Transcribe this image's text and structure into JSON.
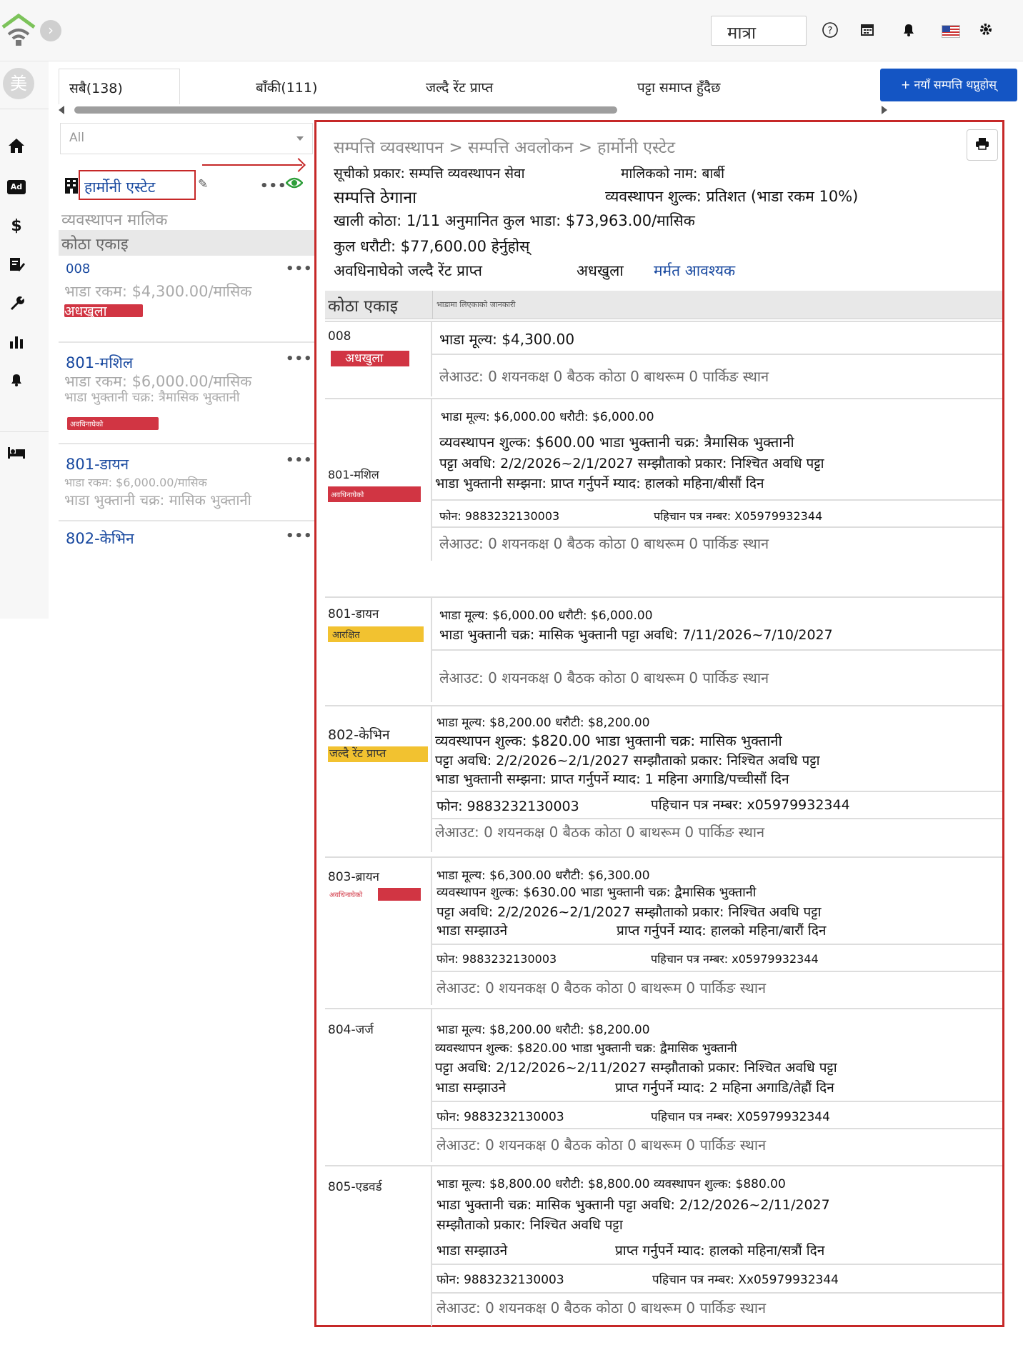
{
  "topbar": {
    "search_value": "मात्रा",
    "icons": [
      "help-icon",
      "calendar-icon",
      "bell-icon",
      "flag-icon",
      "gear-icon"
    ]
  },
  "avatar_text": "美",
  "tabs": [
    {
      "label": "सबै(138)"
    },
    {
      "label": "बाँकी(111)"
    },
    {
      "label": "जल्दै रेंट प्राप्त"
    },
    {
      "label": "पट्टा समाप्त हुँदैछ"
    }
  ],
  "add_button_label": "+ नयाँ सम्पत्ति थप्नुहोस्",
  "filter": {
    "value": "All"
  },
  "sidebar": {
    "property_name": "हार्मोनी एस्टेट",
    "owner_label": "व्यवस्थापन मालिक",
    "unit_header": "कोठा एकाइ",
    "units": [
      {
        "name": "008",
        "line1": "भाडा रकम: $4,300.00/मासिक",
        "badge": "अधखुला"
      },
      {
        "name": "801-मशिल",
        "line1": "भाडा रकम: $6,000.00/मासिक",
        "line2": "भाडा भुक्तानी चक्र: त्रैमासिक भुक्तानी",
        "badge": "अवधिनाघेको"
      },
      {
        "name": "801-डायन",
        "line1": "भाडा रकम: $6,000.00/मासिक",
        "line2": "भाडा भुक्तानी चक्र: मासिक भुक्तानी"
      },
      {
        "name": "802-केभिन"
      }
    ]
  },
  "main": {
    "breadcrumb": "सम्पत्ति व्यवस्थापन > सम्पत्ति अवलोकन > हार्मोनी एस्टेट",
    "list_type": "सूचीको प्रकार: सम्पत्ति व्यवस्थापन सेवा",
    "owner_name": "मालिकको नाम: बार्बी",
    "address_label": "सम्पत्ति ठेगाना",
    "management_fee": "व्यवस्थापन शुल्क: प्रतिशत (भाडा रकम 10%)",
    "vacant": "खाली कोठा: 1/11 अनुमानित कुल भाडा: $73,963.00/मासिक",
    "deposit": "कुल धरौटी: $77,600.00 हेर्नुहोस्",
    "overdue_filter": "अवधिनाघेको जल्दै रेंट प्राप्त",
    "half_open": "अधखुला",
    "repair": "मर्मत आवश्यक",
    "header_unit": "कोठा एकाइ",
    "header_tenant": "भाडामा लिएकाको जानकारी"
  },
  "units": [
    {
      "name": "008",
      "badge": "अधखुला",
      "rent_price": "भाडा मूल्य: $4,300.00",
      "layout": "लेआउट: 0 शयनकक्ष 0 बैठक कोठा 0 बाथरूम 0 पार्किङ स्थान"
    },
    {
      "name": "801-मशिल",
      "badge": "अवधिनाघेको",
      "rent_deposit": "भाडा मूल्य: $6,000.00 धरौटी: $6,000.00",
      "fee_cycle": "व्यवस्थापन शुल्क: $600.00 भाडा भुक्तानी चक्र: त्रैमासिक भुक्तानी",
      "lease": "पट्टा अवधि: 2/2/2026~2/1/2027 सम्झौताको प्रकार: निश्चित अवधि पट्टा",
      "reminder": "भाडा भुक्तानी सम्झना: प्राप्त गर्नुपर्ने म्याद: हालको महिना/बीसौं दिन",
      "phone": "फोन: 9883232130003",
      "id_number": "पहिचान पत्र नम्बर: X05979932344",
      "layout": "लेआउट: 0 शयनकक्ष 0 बैठक कोठा 0 बाथरूम 0 पार्किङ स्थान"
    },
    {
      "name": "801-डायन",
      "badge": "आरक्षित",
      "rent_deposit": "भाडा मूल्य: $6,000.00 धरौटी: $6,000.00",
      "cycle_lease": "भाडा भुक्तानी चक्र: मासिक भुक्तानी पट्टा अवधि: 7/11/2026~7/10/2027",
      "layout": "लेआउट: 0 शयनकक्ष 0 बैठक कोठा 0 बाथरूम 0 पार्किङ स्थान"
    },
    {
      "name": "802-केभिन",
      "badge": "जल्दै रेंट प्राप्त",
      "rent_deposit": "भाडा मूल्य: $8,200.00 धरौटी: $8,200.00",
      "fee_cycle": "व्यवस्थापन शुल्क: $820.00 भाडा भुक्तानी चक्र: मासिक भुक्तानी",
      "lease": "पट्टा अवधि: 2/2/2026~2/1/2027 सम्झौताको प्रकार: निश्चित अवधि पट्टा",
      "reminder": "भाडा भुक्तानी सम्झना: प्राप्त गर्नुपर्ने म्याद: 1 महिना अगाडि/पच्चीसौं दिन",
      "phone": "फोन: 9883232130003",
      "id_number": "पहिचान पत्र नम्बर: x05979932344",
      "layout": "लेआउट: 0 शयनकक्ष 0 बैठक कोठा 0 बाथरूम 0 पार्किङ स्थान"
    },
    {
      "name": "803-ब्रायन",
      "badge": "अवधिनाघेको",
      "rent_deposit": "भाडा मूल्य: $6,300.00 धरौटी: $6,300.00",
      "fee_cycle": "व्यवस्थापन शुल्क: $630.00 भाडा भुक्तानी चक्र: द्वैमासिक भुक्तानी",
      "lease": "पट्टा अवधि: 2/2/2026~2/1/2027 सम्झौताको प्रकार: निश्चित अवधि पट्टा",
      "reminder_label": "भाडा सम्झाउने",
      "reminder_due": "प्राप्त गर्नुपर्ने म्याद: हालको महिना/बारौं दिन",
      "phone": "फोन: 9883232130003",
      "id_number": "पहिचान पत्र नम्बर: x05979932344",
      "layout": "लेआउट: 0 शयनकक्ष 0 बैठक कोठा 0 बाथरूम 0 पार्किङ स्थान"
    },
    {
      "name": "804-जर्ज",
      "rent_deposit": "भाडा मूल्य: $8,200.00 धरौटी: $8,200.00",
      "fee_cycle": "व्यवस्थापन शुल्क: $820.00 भाडा भुक्तानी चक्र: द्वैमासिक भुक्तानी",
      "lease": "पट्टा अवधि: 2/12/2026~2/11/2027 सम्झौताको प्रकार: निश्चित अवधि पट्टा",
      "reminder_label": "भाडा सम्झाउने",
      "reminder_due": "प्राप्त गर्नुपर्ने म्याद: 2 महिना अगाडि/तेह्रौं दिन",
      "phone": "फोन: 9883232130003",
      "id_number": "पहिचान पत्र नम्बर: X05979932344",
      "layout": "लेआउट: 0 शयनकक्ष 0 बैठक कोठा 0 बाथरूम 0 पार्किङ स्थान"
    },
    {
      "name": "805-एडवर्ड",
      "rent_deposit_fee": "भाडा मूल्य: $8,800.00 धरौटी: $8,800.00 व्यवस्थापन शुल्क: $880.00",
      "cycle_lease": "भाडा भुक्तानी चक्र: मासिक भुक्तानी पट्टा अवधि: 2/12/2026~2/11/2027",
      "contract": "सम्झौताको प्रकार: निश्चित अवधि पट्टा",
      "reminder_label": "भाडा सम्झाउने",
      "reminder_due": "प्राप्त गर्नुपर्ने म्याद: हालको महिना/सत्रौं दिन",
      "phone": "फोन: 9883232130003",
      "id_number": "पहिचान पत्र नम्बर: Xx05979932344",
      "layout": "लेआउट: 0 शयनकक्ष 0 बैठक कोठा 0 बाथरूम 0 पार्किङ स्थान"
    }
  ]
}
